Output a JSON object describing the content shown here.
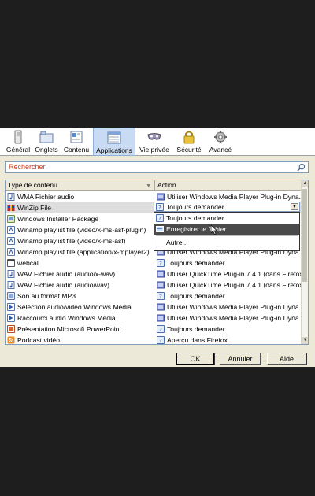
{
  "toolbar": {
    "tabs": [
      {
        "name": "tab-general",
        "label": "Général",
        "icon": "switch-icon"
      },
      {
        "name": "tab-onglets",
        "label": "Onglets",
        "icon": "tabs-icon"
      },
      {
        "name": "tab-contenu",
        "label": "Contenu",
        "icon": "content-icon"
      },
      {
        "name": "tab-applications",
        "label": "Applications",
        "icon": "applications-icon",
        "active": true
      },
      {
        "name": "tab-vie-privee",
        "label": "Vie privée",
        "icon": "mask-icon"
      },
      {
        "name": "tab-securite",
        "label": "Sécurité",
        "icon": "lock-icon"
      },
      {
        "name": "tab-avance",
        "label": "Avancé",
        "icon": "gear-icon"
      }
    ]
  },
  "search": {
    "placeholder": "Rechercher"
  },
  "table": {
    "headers": {
      "type": "Type de contenu",
      "action": "Action"
    },
    "rows": [
      {
        "type": "WMA Fichier audio",
        "action": "Utiliser Windows Media Player Plug-in Dyna...",
        "type_icon": "audio-file-icon",
        "action_icon": "plugin-icon"
      },
      {
        "type": "WinZip File",
        "action": "",
        "type_icon": "winzip-icon",
        "action_icon": "",
        "selected": true
      },
      {
        "type": "Windows Installer Package",
        "action": "",
        "type_icon": "installer-icon",
        "action_icon": ""
      },
      {
        "type": "Winamp playlist file (video/x-ms-asf-plugin)",
        "action": "",
        "type_icon": "winamp-icon",
        "action_icon": ""
      },
      {
        "type": "Winamp playlist file (video/x-ms-asf)",
        "action": "",
        "type_icon": "winamp-icon",
        "action_icon": ""
      },
      {
        "type": "Winamp playlist file (application/x-mplayer2)",
        "action": "Utiliser Windows Media Player Plug-in Dyna...",
        "type_icon": "winamp-icon",
        "action_icon": "plugin-icon"
      },
      {
        "type": "webcal",
        "action": "Toujours demander",
        "type_icon": "webcal-icon",
        "action_icon": "question-icon"
      },
      {
        "type": "WAV Fichier audio (audio/x-wav)",
        "action": "Utiliser QuickTime Plug-in 7.4.1 (dans Firefox)",
        "type_icon": "audio-file-icon",
        "action_icon": "plugin-icon"
      },
      {
        "type": "WAV Fichier audio (audio/wav)",
        "action": "Utiliser QuickTime Plug-in 7.4.1 (dans Firefox)",
        "type_icon": "audio-file-icon",
        "action_icon": "plugin-icon"
      },
      {
        "type": "Son au format MP3",
        "action": "Toujours demander",
        "type_icon": "mp3-icon",
        "action_icon": "question-icon"
      },
      {
        "type": "Sélection audio/vidéo Windows Media",
        "action": "Utiliser Windows Media Player Plug-in Dyna...",
        "type_icon": "media-icon",
        "action_icon": "plugin-icon"
      },
      {
        "type": "Raccourci audio Windows Media",
        "action": "Utiliser Windows Media Player Plug-in Dyna...",
        "type_icon": "media-icon",
        "action_icon": "plugin-icon"
      },
      {
        "type": "Présentation Microsoft PowerPoint",
        "action": "Toujours demander",
        "type_icon": "powerpoint-icon",
        "action_icon": "question-icon"
      },
      {
        "type": "Podcast vidéo",
        "action": "Aperçu dans Firefox",
        "type_icon": "rss-icon",
        "action_icon": "question-icon"
      }
    ]
  },
  "dropdown": {
    "current": "Toujours demander",
    "options": [
      {
        "label": "Toujours demander",
        "icon": "question-icon"
      },
      {
        "label": "Enregistrer le fichier",
        "icon": "save-icon",
        "highlighted": true
      },
      {
        "label": "Autre..."
      }
    ]
  },
  "buttons": {
    "ok": "OK",
    "cancel": "Annuler",
    "help": "Aide"
  },
  "colors": {
    "selected_tab": "#c9dbf2",
    "highlight": "#4a4a4a",
    "search_text": "#d04020"
  }
}
